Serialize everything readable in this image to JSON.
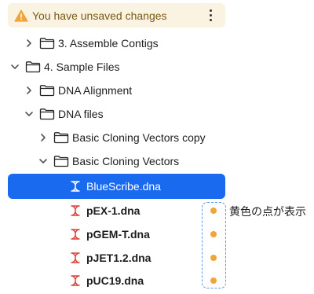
{
  "banner": {
    "message": "You have unsaved changes",
    "status_color": "#f0a43a"
  },
  "tree": {
    "items": [
      {
        "label": "3. Assemble Contigs",
        "expanded": false,
        "kind": "folder"
      },
      {
        "label": "4. Sample Files",
        "expanded": true,
        "kind": "folder"
      },
      {
        "label": "DNA Alignment",
        "expanded": false,
        "kind": "folder"
      },
      {
        "label": "DNA files",
        "expanded": true,
        "kind": "folder"
      },
      {
        "label": "Basic Cloning Vectors copy",
        "expanded": false,
        "kind": "folder"
      },
      {
        "label": "Basic Cloning Vectors",
        "expanded": true,
        "kind": "folder"
      },
      {
        "label": "BlueScribe.dna",
        "kind": "file",
        "selected": true,
        "modified": false
      },
      {
        "label": "pEX-1.dna",
        "kind": "file",
        "modified": true
      },
      {
        "label": "pGEM-T.dna",
        "kind": "file",
        "modified": true
      },
      {
        "label": "pJET1.2.dna",
        "kind": "file",
        "modified": true
      },
      {
        "label": "pUC19.dna",
        "kind": "file",
        "modified": true
      }
    ]
  },
  "annotation": {
    "text": "黄色の点が表示"
  },
  "colors": {
    "accent": "#1a6af0",
    "modified_dot": "#f0a43a",
    "dna_icon": "#e0413a"
  }
}
